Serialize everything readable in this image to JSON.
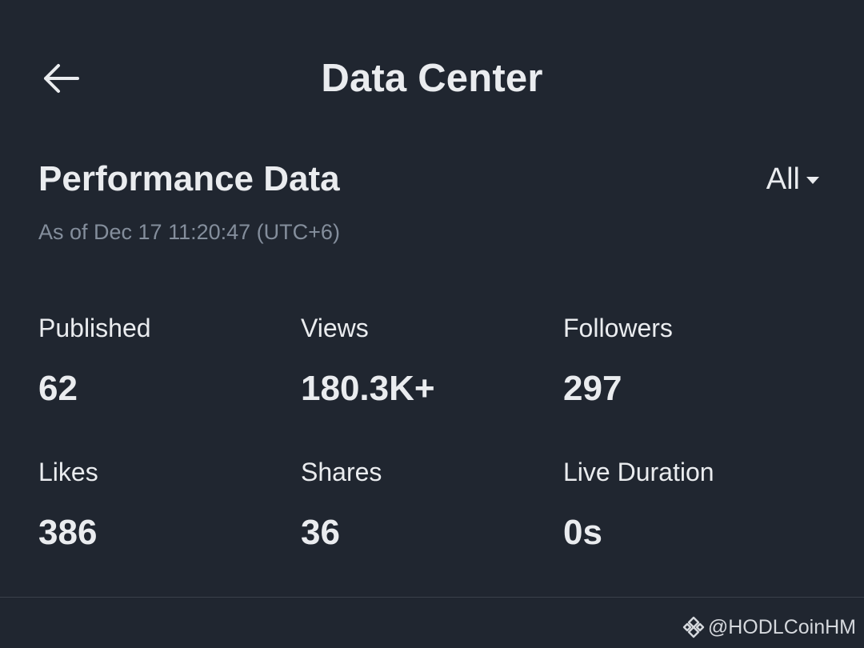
{
  "header": {
    "title": "Data Center",
    "back_icon": "arrow-left-icon"
  },
  "section": {
    "title": "Performance Data",
    "filter_label": "All",
    "timestamp": "As of Dec 17 11:20:47 (UTC+6)"
  },
  "stats": [
    {
      "label": "Published",
      "value": "62"
    },
    {
      "label": "Views",
      "value": "180.3K+"
    },
    {
      "label": "Followers",
      "value": "297"
    },
    {
      "label": "Likes",
      "value": "386"
    },
    {
      "label": "Shares",
      "value": "36"
    },
    {
      "label": "Live Duration",
      "value": "0s"
    }
  ],
  "watermark": {
    "text": "@HODLCoinHM",
    "icon": "binance-logo-icon"
  },
  "colors": {
    "background": "#202630",
    "text_primary": "#EAECEF",
    "text_secondary": "#848E9C"
  }
}
